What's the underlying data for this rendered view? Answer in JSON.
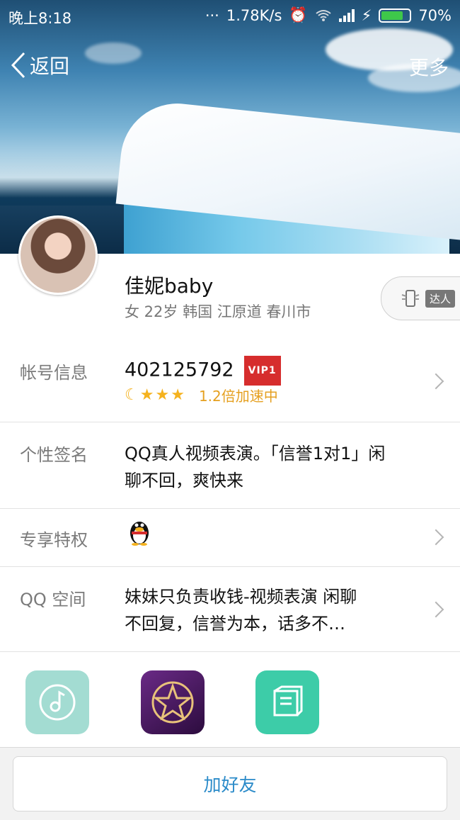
{
  "status_bar": {
    "time": "晚上8:18",
    "dots": "···",
    "net_speed": "1.78K/s",
    "battery": "70%"
  },
  "nav": {
    "back_label": "返回",
    "more_label": "更多"
  },
  "profile": {
    "name": "佳妮baby",
    "info": "女 22岁 韩国 江原道 春川市",
    "talent_tag": "达人"
  },
  "account": {
    "label": "帐号信息",
    "qq_number": "402125792",
    "vip_badge": "VIP1",
    "speed_text": "1.2倍加速中",
    "level_icons": [
      "moon-icon",
      "star-icon",
      "star-icon",
      "star-icon"
    ]
  },
  "signature": {
    "label": "个性签名",
    "line1": "QQ真人视频表演。「信誉1对1」闲",
    "line2": "聊不回，爽快来"
  },
  "privilege": {
    "label": "专享特权",
    "icon": "qq-penguin-icon"
  },
  "qzone": {
    "label": "QQ 空间",
    "line1": "妹妹只负责收钱-视频表演 闲聊",
    "line2": "不回复，信誉为本，话多不…"
  },
  "apps": [
    {
      "icon": "music-app-icon",
      "color": "#a3dcd2"
    },
    {
      "icon": "star-app-icon",
      "color": "#4b1a63"
    },
    {
      "icon": "book-app-icon",
      "color": "#3dcca8"
    }
  ],
  "actions": {
    "add_friend": "加好友"
  },
  "colors": {
    "accent": "#2b8bc9",
    "vip": "#d62d2d",
    "speed": "#e5a020"
  }
}
